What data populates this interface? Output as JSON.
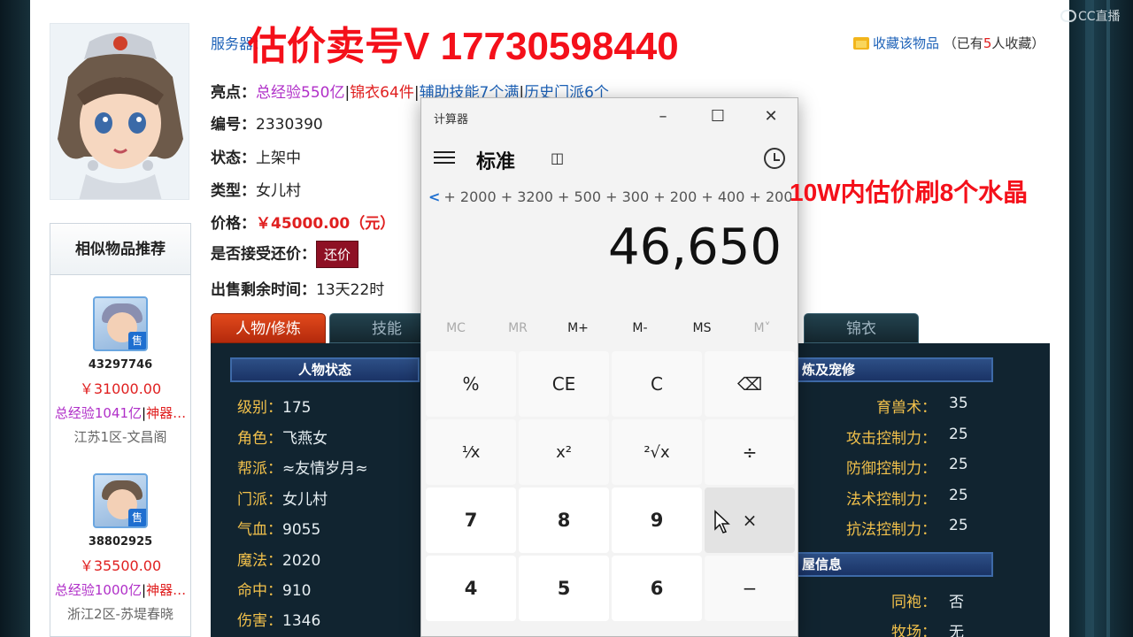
{
  "watermark": "CC直播",
  "header": {
    "server_label": "服务器：",
    "promo_text": "估价卖号V 17730598440",
    "favorite_link": "收藏该物品",
    "favorite_count_prefix": "（已有",
    "favorite_count": "5",
    "favorite_count_suffix": "人收藏）"
  },
  "item": {
    "highlights_label": "亮点：",
    "highlight_1": "总经验550亿",
    "highlight_2": "锦衣64件",
    "highlight_3": "辅助技能7个满",
    "highlight_4": "历史门派6个",
    "id_label": "编号：",
    "id_value": "2330390",
    "status_label": "状态：",
    "status_value": "上架中",
    "type_label": "类型：",
    "type_value": "女儿村",
    "price_label": "价格：",
    "price_value": "￥45000.00（元）",
    "counter_label": "是否接受还价：",
    "counter_button": "还价",
    "remaining_label": "出售剩余时间：",
    "remaining_value": "13天22时"
  },
  "similar": {
    "title": "相似物品推荐",
    "items": [
      {
        "sale": "售",
        "id": "43297746",
        "price": "￥31000.00",
        "tag_1": "总经验1041亿",
        "tag_2": "神器…",
        "location": "江苏1区-文昌阁"
      },
      {
        "sale": "售",
        "id": "38802925",
        "price": "￥35500.00",
        "tag_1": "总经验1000亿",
        "tag_2": "神器…",
        "location": "浙江2区-苏堤春晓"
      }
    ]
  },
  "tabs": [
    "人物/修炼",
    "技能",
    "锦衣"
  ],
  "character": {
    "section_title": "人物状态",
    "stats": [
      {
        "k": "级别：",
        "v": "175"
      },
      {
        "k": "角色：",
        "v": "飞燕女"
      },
      {
        "k": "帮派：",
        "v": "≈友情岁月≈"
      },
      {
        "k": "门派：",
        "v": "女儿村"
      },
      {
        "k": "气血：",
        "v": "9055"
      },
      {
        "k": "魔法：",
        "v": "2020"
      },
      {
        "k": "命中：",
        "v": "910"
      },
      {
        "k": "伤害：",
        "v": "1346"
      }
    ]
  },
  "cultivation": {
    "section_title": "炼及宠修",
    "stats": [
      {
        "k": "育兽术：",
        "v": "35"
      },
      {
        "k": "攻击控制力：",
        "v": "25"
      },
      {
        "k": "防御控制力：",
        "v": "25"
      },
      {
        "k": "法术控制力：",
        "v": "25"
      },
      {
        "k": "抗法控制力：",
        "v": "25"
      }
    ],
    "section2_title": "屋信息",
    "stats2": [
      {
        "k": "同袍：",
        "v": "否"
      },
      {
        "k": "牧场：",
        "v": "无"
      }
    ]
  },
  "calculator": {
    "title": "计算器",
    "mode": "标准",
    "expression": "+ 2000 + 3200 + 500 + 300 + 200 + 400 + 200 +",
    "result": "46,650",
    "memory": [
      "MC",
      "MR",
      "M+",
      "M-",
      "MS",
      "M˅"
    ],
    "keys_row1": [
      "%",
      "CE",
      "C",
      "⌫"
    ],
    "keys_row2": [
      "¹⁄x",
      "x²",
      "²√x",
      "÷"
    ],
    "keys_row3": [
      "7",
      "8",
      "9",
      "×"
    ],
    "keys_row4": [
      "4",
      "5",
      "6",
      "−"
    ]
  },
  "overlay": "10W内估价刷8个水晶"
}
